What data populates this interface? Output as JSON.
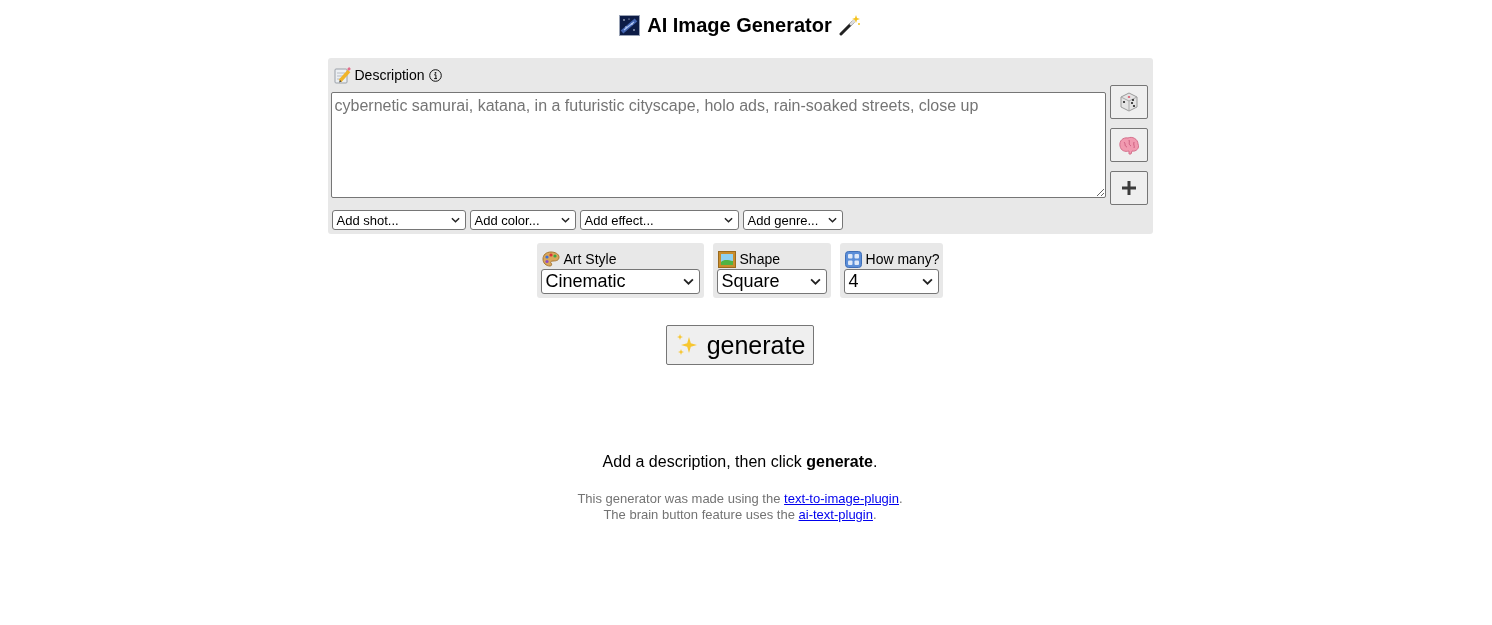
{
  "header": {
    "title": "AI Image Generator"
  },
  "description": {
    "label": "Description",
    "placeholder": "cybernetic samurai, katana, in a futuristic cityscape, holo ads, rain-soaked streets, close up",
    "side_buttons": [
      {
        "kind": "dice"
      },
      {
        "kind": "brain"
      },
      {
        "kind": "plus"
      }
    ],
    "modifiers": [
      {
        "value": "Add shot..."
      },
      {
        "value": "Add color..."
      },
      {
        "value": "Add effect..."
      },
      {
        "value": "Add genre..."
      }
    ]
  },
  "options": [
    {
      "kind": "palette",
      "label": "Art Style",
      "value": "Cinematic"
    },
    {
      "kind": "picture",
      "label": "Shape",
      "value": "Square"
    },
    {
      "kind": "numbers",
      "label": "How many?",
      "value": "4"
    }
  ],
  "generate_button": {
    "label": "generate"
  },
  "message": "Add a description, then click **generate**.",
  "credits": [
    {
      "before": "This generator was made using the",
      "link": "text-to-image-plugin",
      "after": "."
    },
    {
      "before": "The brain button feature uses the",
      "link": "ai-text-plugin",
      "after": "."
    }
  ]
}
